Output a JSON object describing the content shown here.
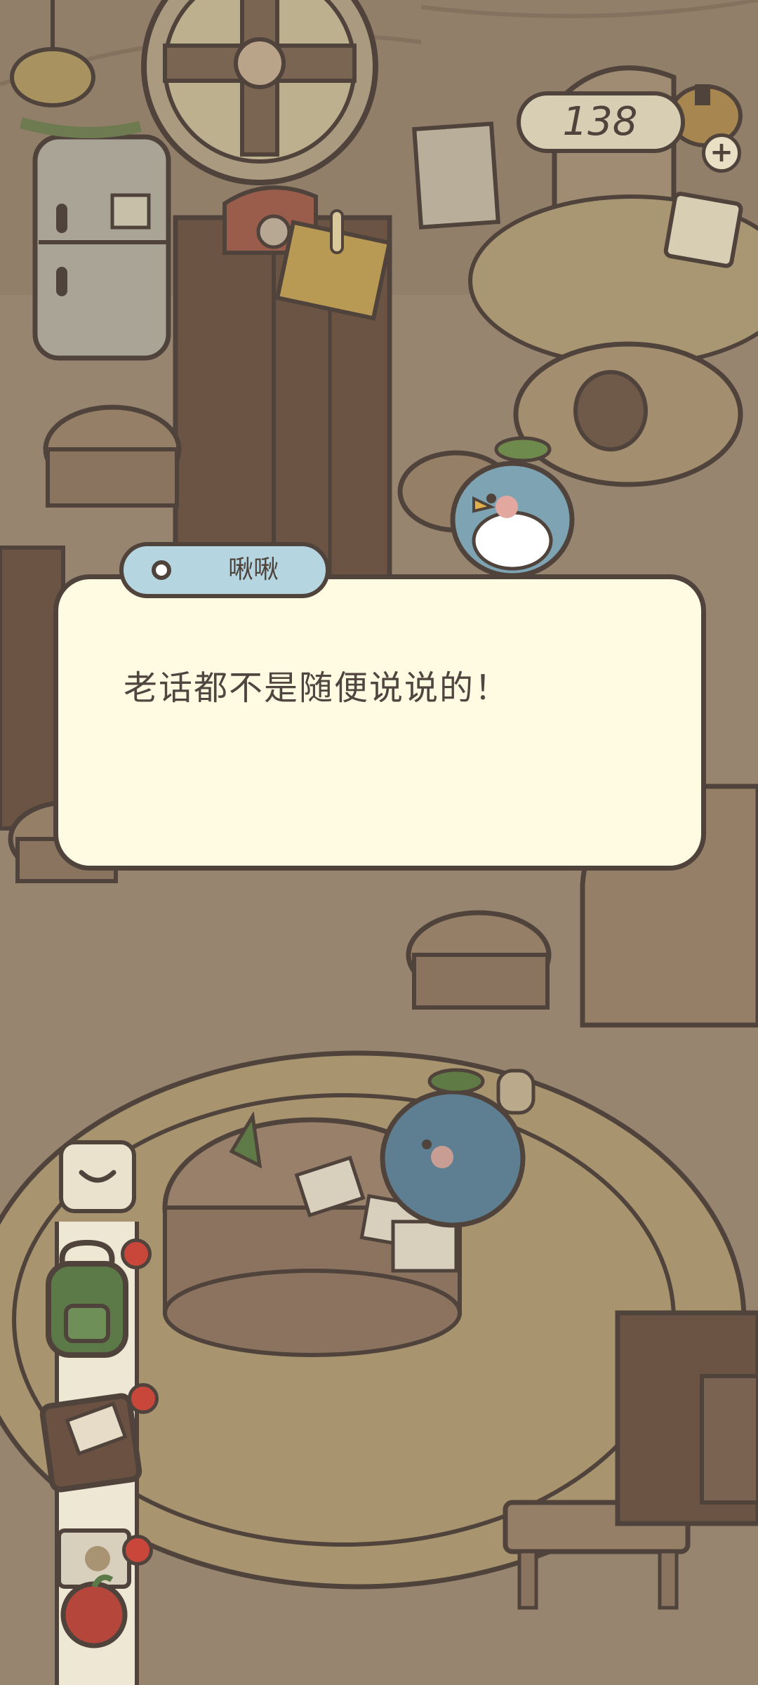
{
  "hud": {
    "coin_count": "138",
    "add_coin_label": "+"
  },
  "dialogue": {
    "speaker": "啾啾",
    "text": "老话都不是随便说说的！"
  },
  "colors": {
    "dim_overlay": "#8f7c66",
    "dialog_background": "#fffbe2",
    "name_tag_background": "#b5d6e0",
    "outline": "#4f433c",
    "notification": "#c8463a"
  },
  "toolbar": {
    "items": [
      {
        "name": "backpack",
        "icon": "backpack-icon",
        "has_notification": true
      },
      {
        "name": "notebook",
        "icon": "notebook-icon",
        "has_notification": true
      },
      {
        "name": "letters",
        "icon": "letters-icon",
        "has_notification": true
      }
    ]
  }
}
